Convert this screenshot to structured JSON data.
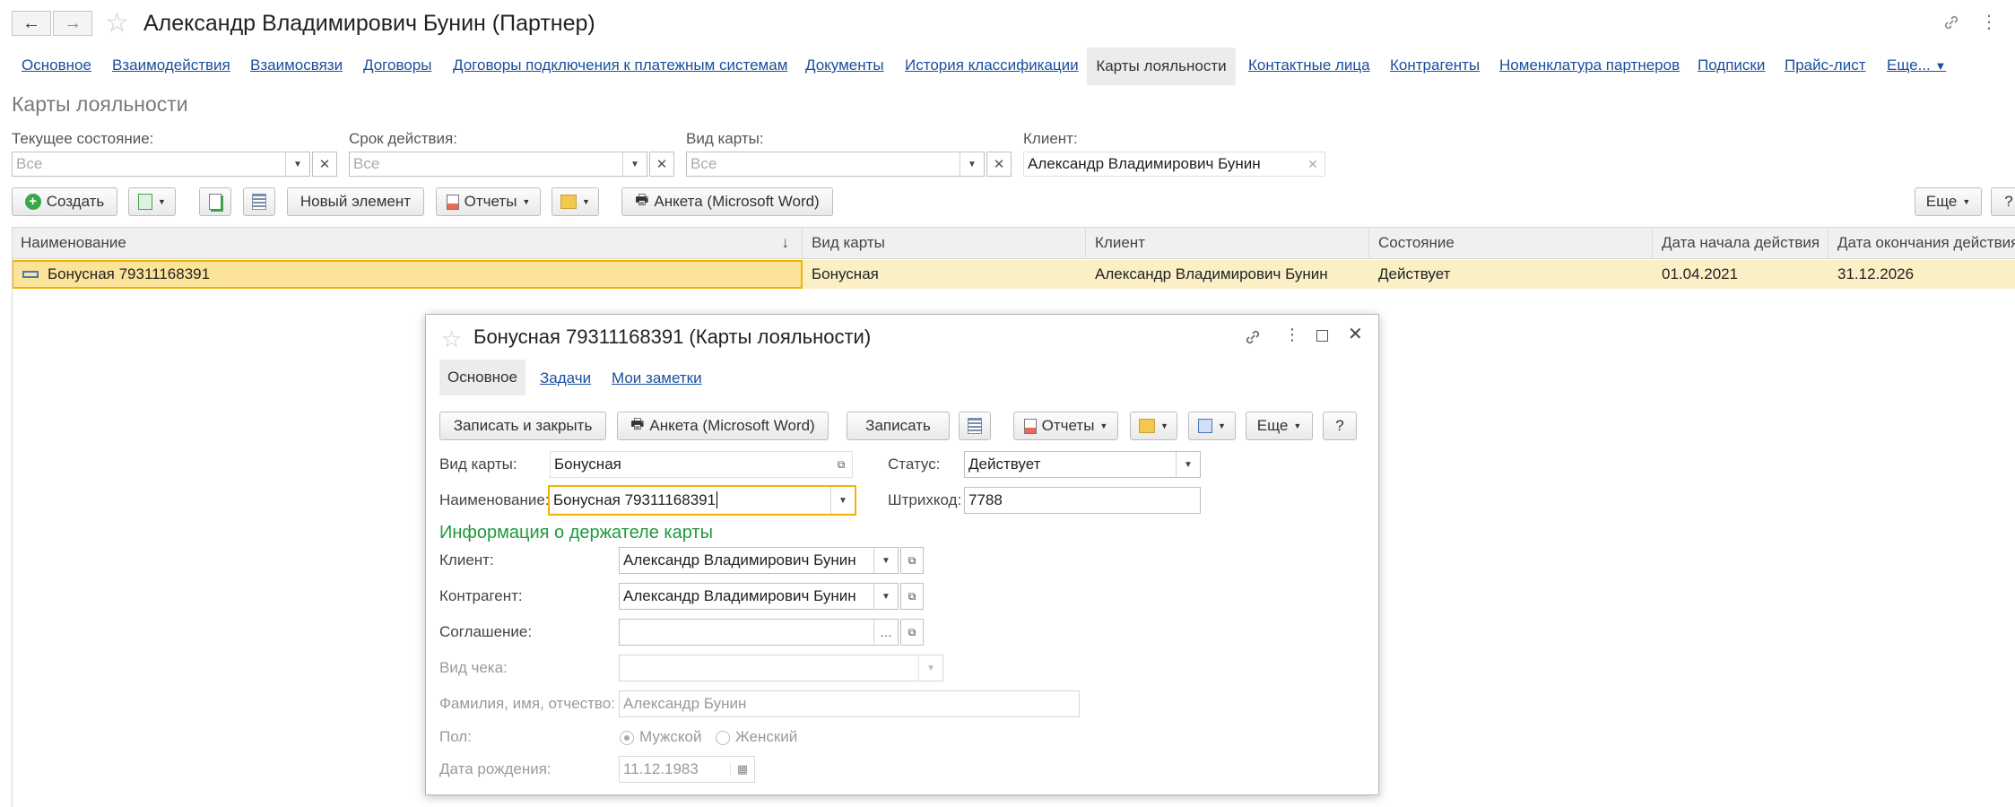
{
  "window": {
    "title": "Александр Владимирович Бунин (Партнер)"
  },
  "tabs": [
    "Основное",
    "Взаимодействия",
    "Взаимосвязи",
    "Договоры",
    "Договоры подключения к платежным системам",
    "Документы",
    "История классификации",
    "Карты лояльности",
    "Контактные лица",
    "Контрагенты",
    "Номенклатура партнеров",
    "Подписки",
    "Прайс-лист",
    "Еще..."
  ],
  "section_title": "Карты лояльности",
  "filters": {
    "state_label": "Текущее состояние:",
    "state_value": "Все",
    "period_label": "Срок действия:",
    "period_value": "Все",
    "card_kind_label": "Вид карты:",
    "card_kind_value": "Все",
    "client_label": "Клиент:",
    "client_value": "Александр Владимирович Бунин"
  },
  "toolbar": {
    "create": "Создать",
    "new_element": "Новый элемент",
    "reports": "Отчеты",
    "form_word": "Анкета (Microsoft Word)",
    "more": "Еще",
    "help": "?"
  },
  "grid": {
    "columns": [
      "Наименование",
      "Вид карты",
      "Клиент",
      "Состояние",
      "Дата начала действия",
      "Дата окончания действия"
    ],
    "rows": [
      [
        "Бонусная 79311168391",
        "Бонусная",
        "Александр Владимирович Бунин",
        "Действует",
        "01.04.2021",
        "31.12.2026"
      ]
    ]
  },
  "dialog": {
    "title": "Бонусная 79311168391 (Карты лояльности)",
    "tabs": [
      "Основное",
      "Задачи",
      "Мои заметки"
    ],
    "buttons": {
      "save_close": "Записать и закрыть",
      "form_word": "Анкета (Microsoft Word)",
      "save": "Записать",
      "reports": "Отчеты",
      "more": "Еще",
      "help": "?"
    },
    "fields": {
      "card_kind_label": "Вид карты:",
      "card_kind_value": "Бонусная",
      "status_label": "Статус:",
      "status_value": "Действует",
      "name_label": "Наименование:",
      "name_value": "Бонусная 79311168391",
      "barcode_label": "Штрихкод:",
      "barcode_value": "7788"
    },
    "holder_section": "Информация о держателе карты",
    "holder": {
      "client_label": "Клиент:",
      "client_value": "Александр Владимирович Бунин",
      "counterparty_label": "Контрагент:",
      "counterparty_value": "Александр Владимирович Бунин",
      "agreement_label": "Соглашение:",
      "agreement_value": "",
      "receipt_kind_label": "Вид чека:",
      "receipt_kind_value": "",
      "fio_label": "Фамилия, имя, отчество:",
      "fio_value": "Александр Бунин",
      "gender_label": "Пол:",
      "gender_male": "Мужской",
      "gender_female": "Женский",
      "birth_label": "Дата рождения:",
      "birth_value": "11.12.1983"
    }
  },
  "colors": {
    "link": "#1a4f9c",
    "row_selected": "#fbefc6",
    "focus_border": "#f0b400",
    "section_green": "#1f9a3c"
  }
}
